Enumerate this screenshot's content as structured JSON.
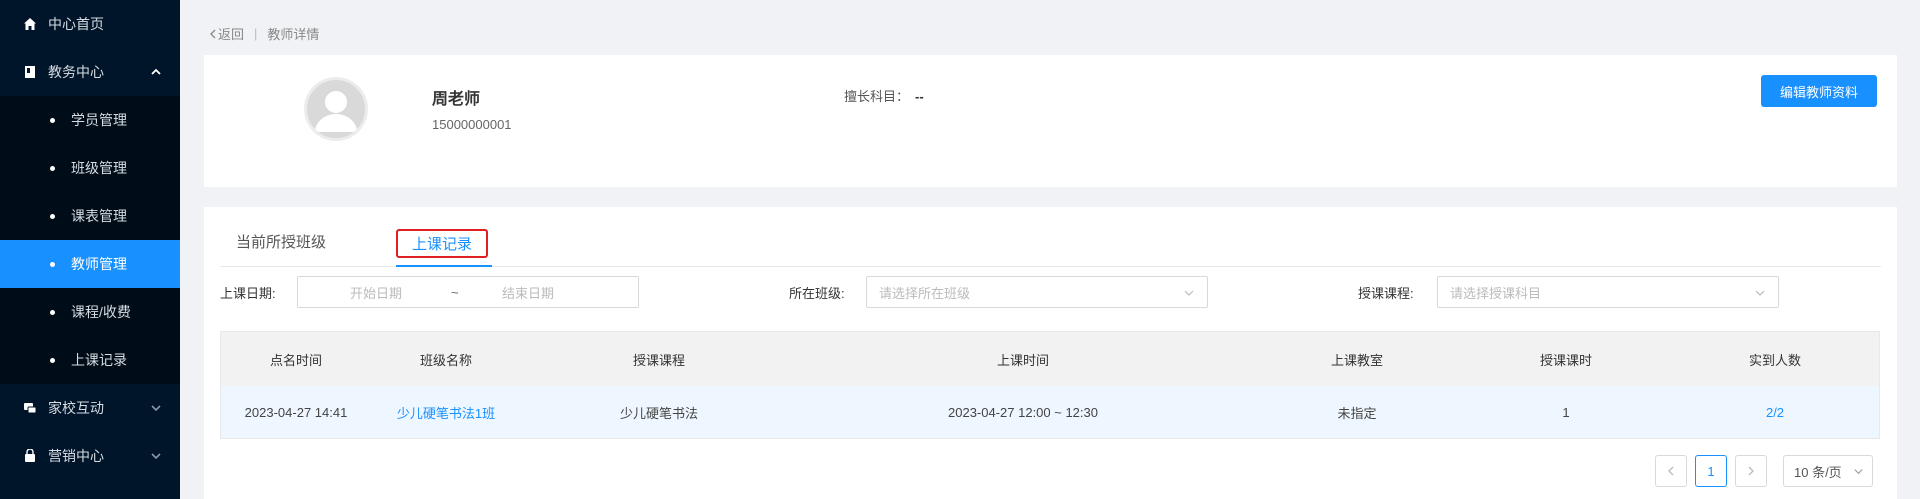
{
  "sidebar": {
    "items": [
      {
        "label": "中心首页",
        "icon": "home-icon"
      },
      {
        "label": "教务中心",
        "icon": "book-icon",
        "expanded": true
      },
      {
        "label": "家校互动",
        "icon": "chat-icon",
        "expanded": false
      },
      {
        "label": "营销中心",
        "icon": "shop-icon",
        "expanded": false
      }
    ],
    "submenu": [
      {
        "label": "学员管理"
      },
      {
        "label": "班级管理"
      },
      {
        "label": "课表管理"
      },
      {
        "label": "教师管理",
        "active": true
      },
      {
        "label": "课程/收费"
      },
      {
        "label": "上课记录"
      }
    ]
  },
  "breadcrumb": {
    "back": "返回",
    "separator": "|",
    "current": "教师详情"
  },
  "teacher": {
    "name": "周老师",
    "phone": "15000000001",
    "subject_label": "擅长科目：",
    "subject_value": "--",
    "edit_button": "编辑教师资料"
  },
  "tabs": [
    {
      "label": "当前所授班级"
    },
    {
      "label": "上课记录",
      "active": true
    }
  ],
  "filters": {
    "date_label": "上课日期:",
    "start_placeholder": "开始日期",
    "range_separator": "~",
    "end_placeholder": "结束日期",
    "class_label": "所在班级:",
    "class_placeholder": "请选择所在班级",
    "course_label": "授课课程:",
    "course_placeholder": "请选择授课科目"
  },
  "table": {
    "columns": [
      "点名时间",
      "班级名称",
      "授课课程",
      "上课时间",
      "上课教室",
      "授课课时",
      "实到人数"
    ],
    "rows": [
      [
        "2023-04-27 14:41",
        "少儿硬笔书法1班",
        "少儿硬笔书法",
        "2023-04-27 12:00 ~ 12:30",
        "未指定",
        "1",
        "2/2"
      ]
    ]
  },
  "pagination": {
    "current_page": "1",
    "page_size": "10 条/页"
  },
  "colors": {
    "primary": "#1890ff",
    "sidebar_bg": "#001529",
    "tab_highlight_border": "#e02020"
  }
}
